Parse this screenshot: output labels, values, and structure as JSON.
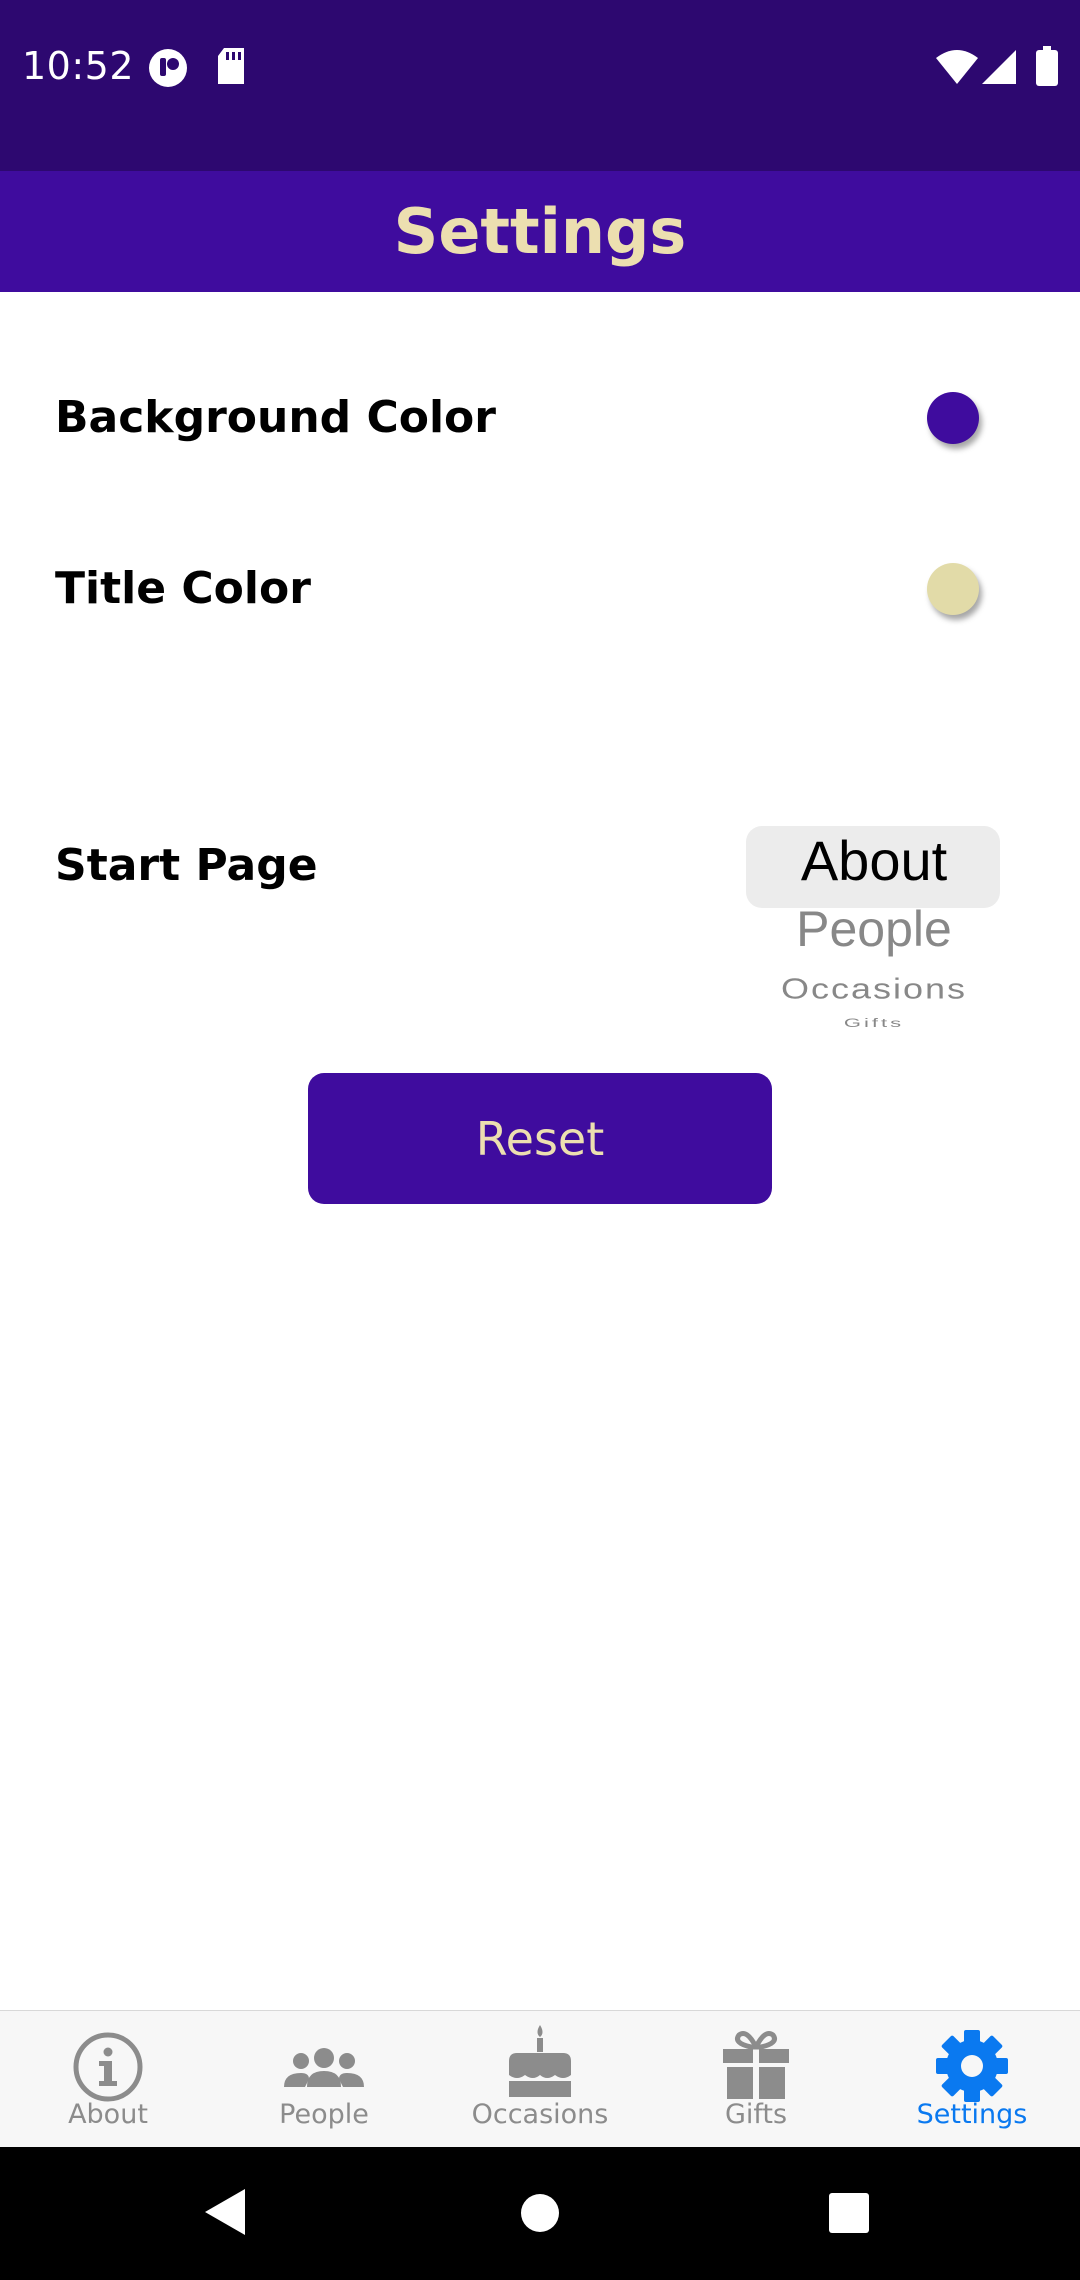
{
  "status_bar": {
    "time": "10:52"
  },
  "header": {
    "title": "Settings"
  },
  "settings": {
    "background_color": {
      "label": "Background Color",
      "color": "#3f0c9e"
    },
    "title_color": {
      "label": "Title Color",
      "color": "#e2dba8"
    },
    "start_page": {
      "label": "Start Page",
      "options": [
        "About",
        "People",
        "Occasions",
        "Gifts"
      ],
      "selected": "About"
    },
    "reset_label": "Reset"
  },
  "bottom_nav": {
    "active_color": "#0a79f0",
    "inactive_color": "#8c8c8c",
    "tabs": [
      {
        "label": "About",
        "icon": "info-icon",
        "active": false
      },
      {
        "label": "People",
        "icon": "people-icon",
        "active": false
      },
      {
        "label": "Occasions",
        "icon": "cake-icon",
        "active": false
      },
      {
        "label": "Gifts",
        "icon": "gift-icon",
        "active": false
      },
      {
        "label": "Settings",
        "icon": "gear-icon",
        "active": true
      }
    ]
  }
}
